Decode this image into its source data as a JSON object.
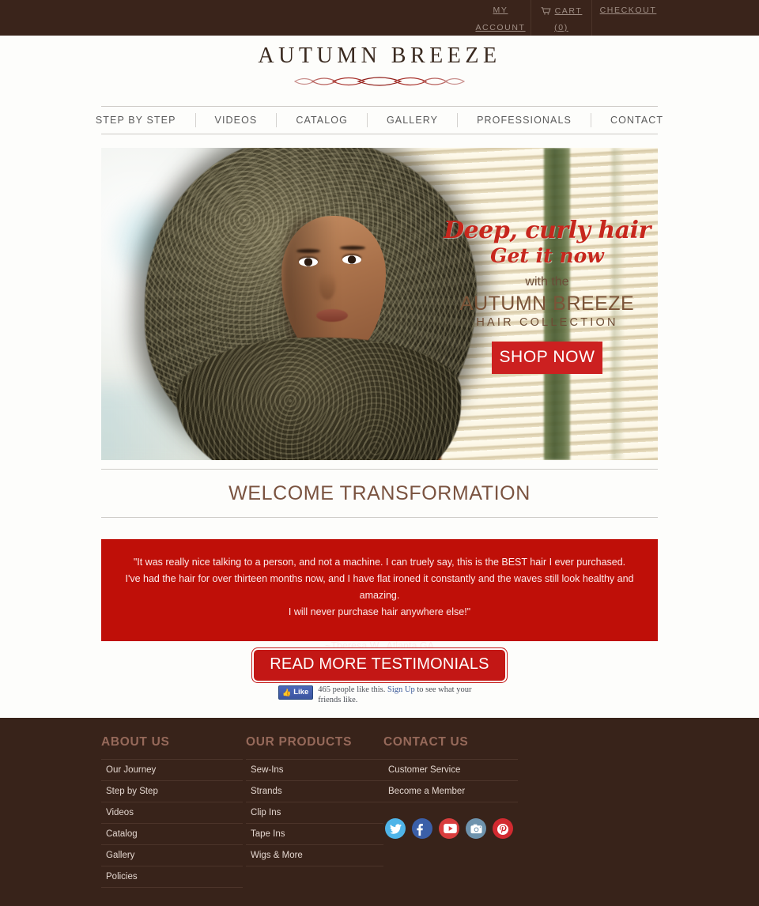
{
  "topbar": {
    "account_line1": "MY",
    "account_line2": "ACCOUNT",
    "cart_label": "CART",
    "cart_count": "(0)",
    "checkout_label": "CHECKOUT"
  },
  "logo": {
    "text": "AUTUMN BREEZE"
  },
  "nav": {
    "items": [
      {
        "label": "STEP BY STEP"
      },
      {
        "label": "VIDEOS"
      },
      {
        "label": "CATALOG"
      },
      {
        "label": "GALLERY"
      },
      {
        "label": "PROFESSIONALS"
      },
      {
        "label": "CONTACT"
      }
    ]
  },
  "hero": {
    "headline1": "Deep, curly hair",
    "headline2": "Get it now",
    "sub1": "with the",
    "sub2": "AUTUMN BREEZE",
    "sub3": "HAIR COLLECTION",
    "cta": "SHOP NOW"
  },
  "welcome": {
    "title": "WELCOME TRANSFORMATION"
  },
  "testimonial": {
    "line1": "\"It was really nice talking to a person, and not a machine. I can truely say, this is the BEST hair I ever purchased.",
    "line2": "I've had the hair for over thirteen months now, and I have flat ironed it constantly and the waves still look healthy and amazing.",
    "line3": "I will never purchase hair anywhere else!\"",
    "author": "~Theresa W., Atlanta GA",
    "read_more": "READ MORE TESTIMONIALS"
  },
  "facebook": {
    "like_label": "Like",
    "count_text": "465 people like this.",
    "signup_link": "Sign Up",
    "tail_text": " to see what your friends like."
  },
  "footer": {
    "columns": [
      {
        "heading": "ABOUT US",
        "links": [
          {
            "label": "Our Journey"
          },
          {
            "label": "Step by Step"
          },
          {
            "label": "Videos"
          },
          {
            "label": "Catalog"
          },
          {
            "label": "Gallery"
          },
          {
            "label": "Policies"
          }
        ]
      },
      {
        "heading": "OUR PRODUCTS",
        "links": [
          {
            "label": "Sew-Ins"
          },
          {
            "label": "Strands"
          },
          {
            "label": "Clip Ins"
          },
          {
            "label": "Tape Ins"
          },
          {
            "label": "Wigs & More"
          }
        ]
      },
      {
        "heading": "CONTACT US",
        "links": [
          {
            "label": "Customer Service"
          },
          {
            "label": "Become a Member"
          }
        ]
      }
    ],
    "social": [
      {
        "name": "twitter",
        "color": "#4fb4e8"
      },
      {
        "name": "facebook",
        "color": "#3b5fa8"
      },
      {
        "name": "youtube",
        "color": "#d93d3d"
      },
      {
        "name": "instagram",
        "color": "#6e93ad"
      },
      {
        "name": "pinterest",
        "color": "#d22a30"
      }
    ]
  },
  "colors": {
    "dark_brown": "#38231a",
    "accent_red": "#bf0f08",
    "brand_brown": "#7a5340",
    "hero_red": "#c7271d"
  }
}
